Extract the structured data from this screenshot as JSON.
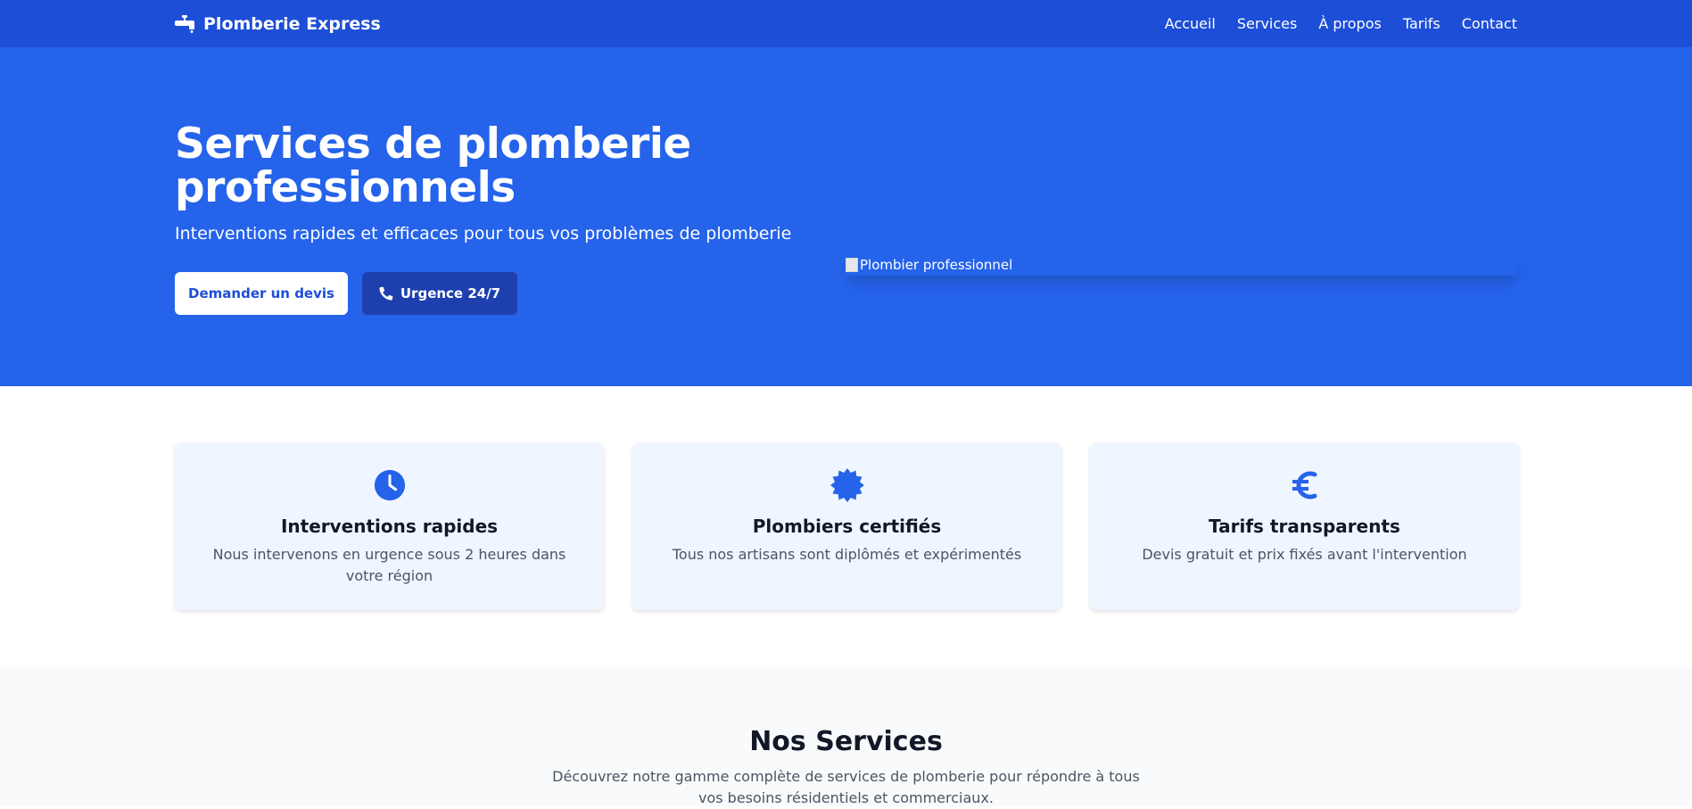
{
  "nav": {
    "brand": "Plomberie Express",
    "links": [
      "Accueil",
      "Services",
      "À propos",
      "Tarifs",
      "Contact"
    ]
  },
  "hero": {
    "title_line1": "Services de plomberie",
    "title_line2": "professionnels",
    "subtitle": "Interventions rapides et efficaces pour tous vos problèmes de plomberie",
    "btn_quote": "Demander un devis",
    "btn_urgent": "Urgence 24/7",
    "image_alt": "Plombier professionnel"
  },
  "features": [
    {
      "icon": "clock-icon",
      "title": "Interventions rapides",
      "desc": "Nous intervenons en urgence sous 2 heures dans votre région"
    },
    {
      "icon": "certificate-icon",
      "title": "Plombiers certifiés",
      "desc": "Tous nos artisans sont diplômés et expérimentés"
    },
    {
      "icon": "euro-icon",
      "title": "Tarifs transparents",
      "desc": "Devis gratuit et prix fixés avant l'intervention"
    }
  ],
  "services": {
    "title": "Nos Services",
    "desc": "Découvrez notre gamme complète de services de plomberie pour répondre à tous vos besoins résidentiels et commerciaux."
  },
  "colors": {
    "nav_bg": "#1d4ed8",
    "hero_bg": "#2563eb",
    "accent": "#2563eb",
    "card_bg": "#eff6ff",
    "urgent_btn": "#1e40af"
  }
}
